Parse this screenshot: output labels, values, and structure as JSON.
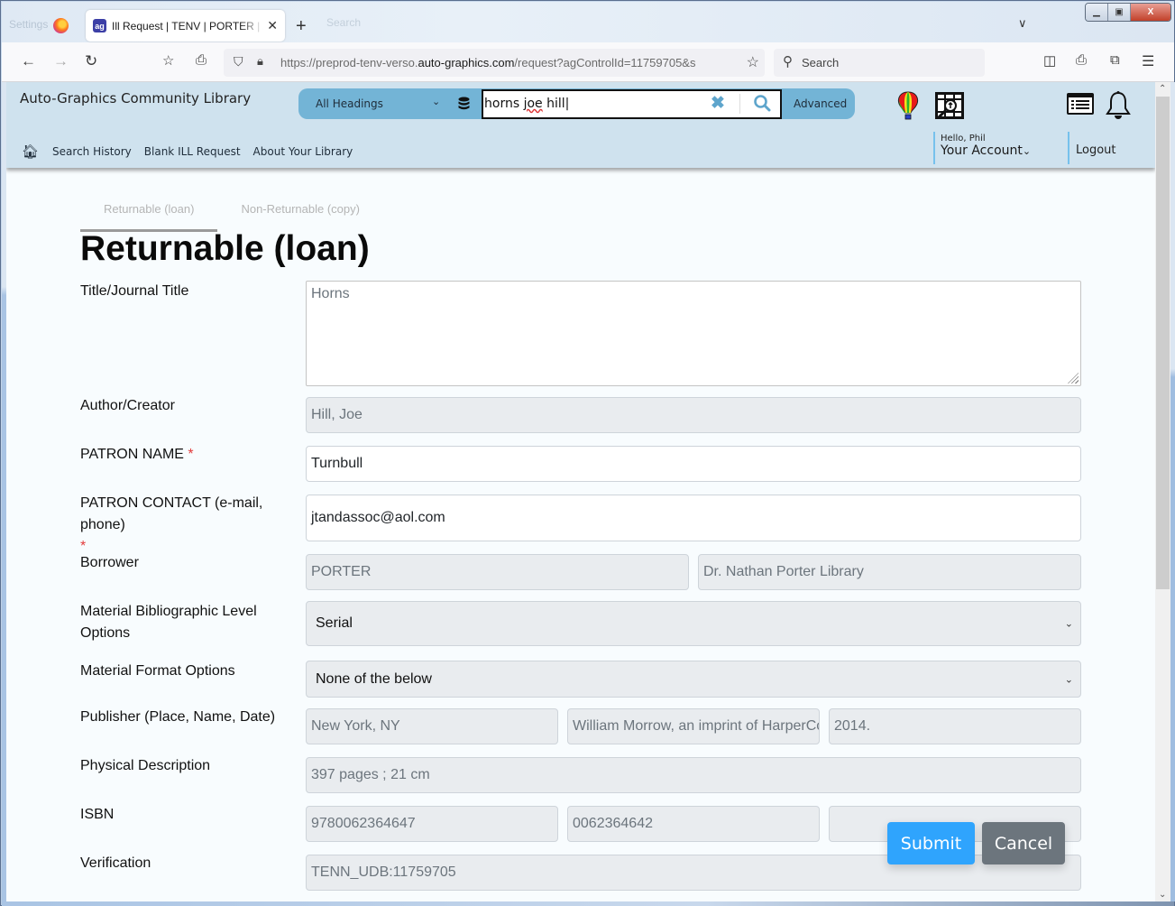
{
  "browser": {
    "tab": {
      "title": "Ill Request | TENV | PORTER | Auto-Graphics",
      "favicon": "ag-logo-icon"
    },
    "ghost_tab_label": "Settings",
    "ghost_search": "Search",
    "url": {
      "prefix": "https://preprod-tenv-verso.",
      "domain": "auto-graphics.com",
      "path": "/request?agControlId=11759705&s"
    },
    "search_placeholder": "Search",
    "icons": [
      "back-icon",
      "forward-icon",
      "reload-icon",
      "bookmark-star-icon",
      "share-icon",
      "shield-icon",
      "lock-icon",
      "pocket-icon",
      "print-icon",
      "extensions-icon",
      "menu-icon"
    ]
  },
  "header": {
    "library_name": "Auto-Graphics Community Library",
    "search_scope": "All Headings",
    "search_query": {
      "before": "horns ",
      "misspelled": "joe",
      "after": " hill"
    },
    "advanced_label": "Advanced",
    "subnav": [
      "Search History",
      "Blank ILL Request",
      "About Your Library"
    ],
    "greeting": "Hello, Phil",
    "account_label": "Your Account",
    "logout_label": "Logout"
  },
  "form": {
    "tabs": [
      {
        "label": "Returnable (loan)",
        "active": true
      },
      {
        "label": "Non-Returnable (copy)",
        "active": false
      }
    ],
    "title": "Returnable (loan)",
    "fields": {
      "title": {
        "label": "Title/Journal Title",
        "value": "Horns"
      },
      "author": {
        "label": "Author/Creator",
        "value": "Hill, Joe"
      },
      "patron_name": {
        "label": "PATRON NAME",
        "required": "*",
        "value": "Turnbull"
      },
      "patron_contact": {
        "label": "PATRON CONTACT (e-mail, phone)",
        "required": "*",
        "value": "jtandassoc@aol.com"
      },
      "borrower": {
        "label": "Borrower",
        "code": "PORTER",
        "name": "Dr. Nathan Porter Library"
      },
      "bib_level": {
        "label_line1": "Material Bibliographic Level",
        "label_line2": "Options",
        "selected": "Serial"
      },
      "format": {
        "label": "Material Format Options",
        "selected": "None of the below"
      },
      "publisher": {
        "label": "Publisher (Place, Name, Date)",
        "place": "New York, NY",
        "name": "William Morrow, an imprint of HarperCollins Publishers",
        "date": "2014."
      },
      "physical": {
        "label": "Physical Description",
        "value": "397 pages ; 21 cm"
      },
      "isbn": {
        "label": "ISBN",
        "isbn13": "9780062364647",
        "isbn10": "0062364642",
        "extra": ""
      },
      "verification": {
        "label": "Verification",
        "value": "TENN_UDB:11759705"
      }
    },
    "submit_label": "Submit",
    "cancel_label": "Cancel"
  },
  "colors": {
    "header_bg": "#cfe2ee",
    "search_group": "#73b4d6",
    "submit": "#2fa4fd",
    "cancel": "#6c757d",
    "required": "#e23b3b"
  }
}
